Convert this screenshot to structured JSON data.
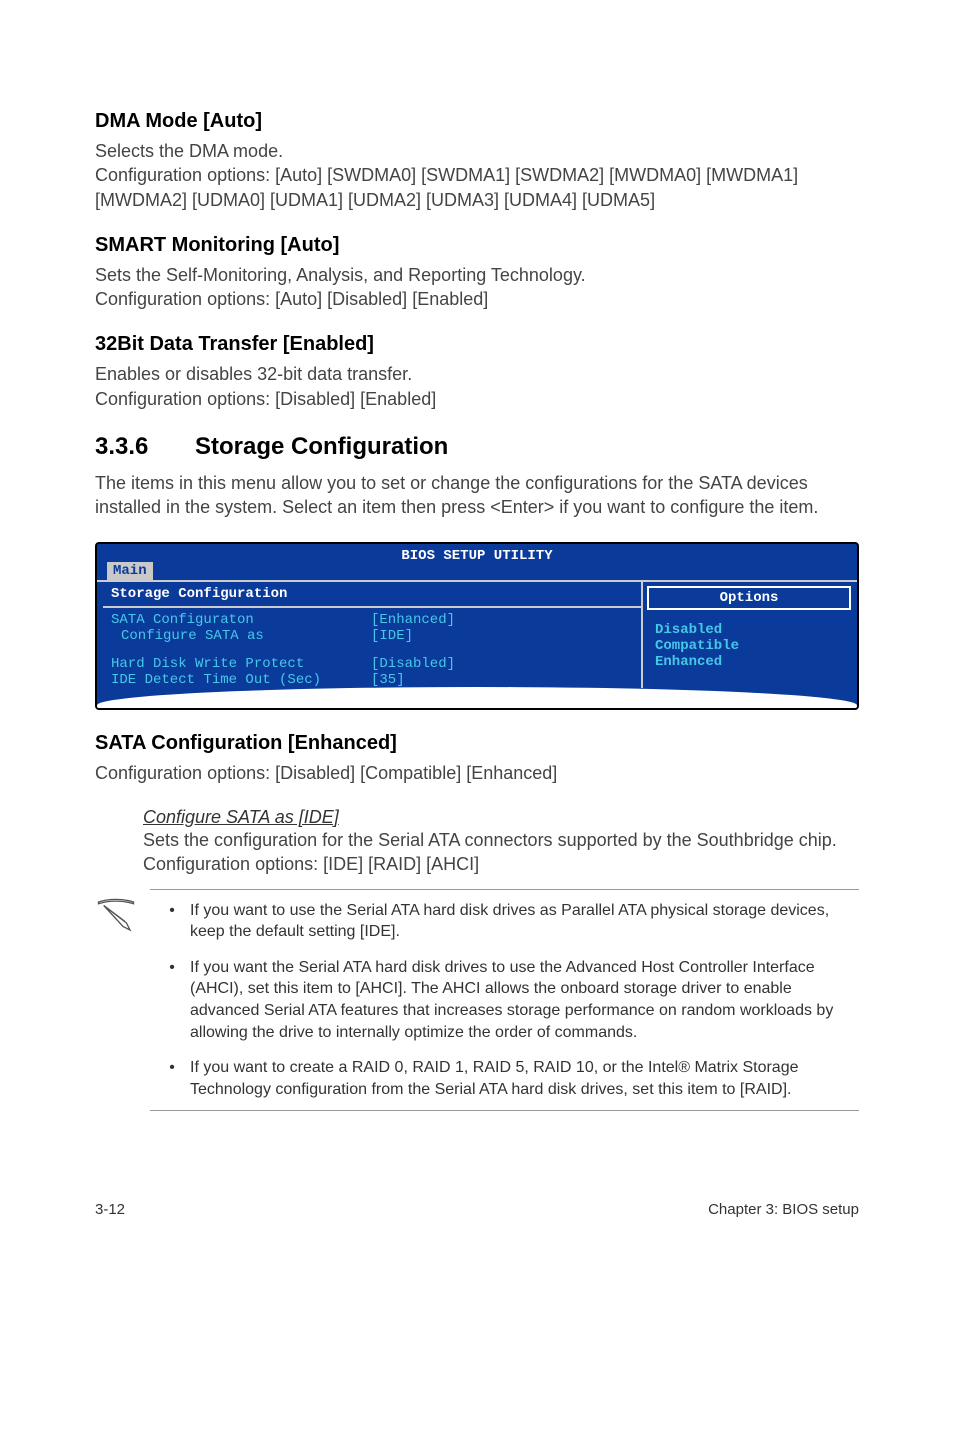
{
  "dma": {
    "title": "DMA Mode [Auto]",
    "line1": "Selects the DMA mode.",
    "line2": "Configuration options: [Auto] [SWDMA0] [SWDMA1] [SWDMA2] [MWDMA0] [MWDMA1] [MWDMA2] [UDMA0] [UDMA1] [UDMA2] [UDMA3] [UDMA4] [UDMA5]"
  },
  "smart": {
    "title": "SMART Monitoring [Auto]",
    "line1": "Sets the Self-Monitoring, Analysis, and Reporting Technology.",
    "line2": "Configuration options: [Auto] [Disabled] [Enabled]"
  },
  "bit32": {
    "title": "32Bit Data Transfer [Enabled]",
    "line1": "Enables or disables 32-bit data transfer.",
    "line2": "Configuration options: [Disabled] [Enabled]"
  },
  "section": {
    "num": "3.3.6",
    "title": "Storage Configuration",
    "intro": "The items in this menu allow you to set or change the configurations for the SATA devices installed in the system. Select an item then press <Enter> if you want to configure the item."
  },
  "bios": {
    "title": "BIOS SETUP UTILITY",
    "tab": "Main",
    "heading": "Storage Configuration",
    "rows": [
      {
        "k": "SATA Configuraton",
        "v": "[Enhanced]",
        "indent": false
      },
      {
        "k": "Configure SATA as",
        "v": "[IDE]",
        "indent": true
      }
    ],
    "rows2": [
      {
        "k": "Hard Disk Write Protect",
        "v": "[Disabled]",
        "indent": false
      },
      {
        "k": "IDE Detect Time Out (Sec)",
        "v": "[35]",
        "indent": false
      }
    ],
    "options_title": "Options",
    "options": [
      "Disabled",
      "Compatible",
      "Enhanced"
    ]
  },
  "sata": {
    "title": "SATA Configuration [Enhanced]",
    "body": "Configuration options: [Disabled] [Compatible] [Enhanced]",
    "sub_title": "Configure SATA as [IDE]",
    "sub_body": "Sets the configuration for the Serial ATA connectors supported by the Southbridge chip. Configuration options: [IDE] [RAID] [AHCI]"
  },
  "notes": {
    "items": [
      "If you want to use the Serial ATA hard disk drives as Parallel ATA physical storage devices, keep the default setting [IDE].",
      "If you want the Serial ATA hard disk drives to use the Advanced Host Controller Interface (AHCI), set this item to [AHCI]. The AHCI allows the onboard storage driver to enable advanced Serial ATA features that increases storage performance on random workloads by allowing the drive to internally optimize the order of commands.",
      "If you want to create a RAID 0, RAID 1, RAID 5, RAID 10, or the Intel® Matrix Storage Technology configuration from the Serial ATA hard disk drives, set this item to [RAID]."
    ]
  },
  "footer": {
    "left": "3-12",
    "right": "Chapter 3: BIOS setup"
  }
}
